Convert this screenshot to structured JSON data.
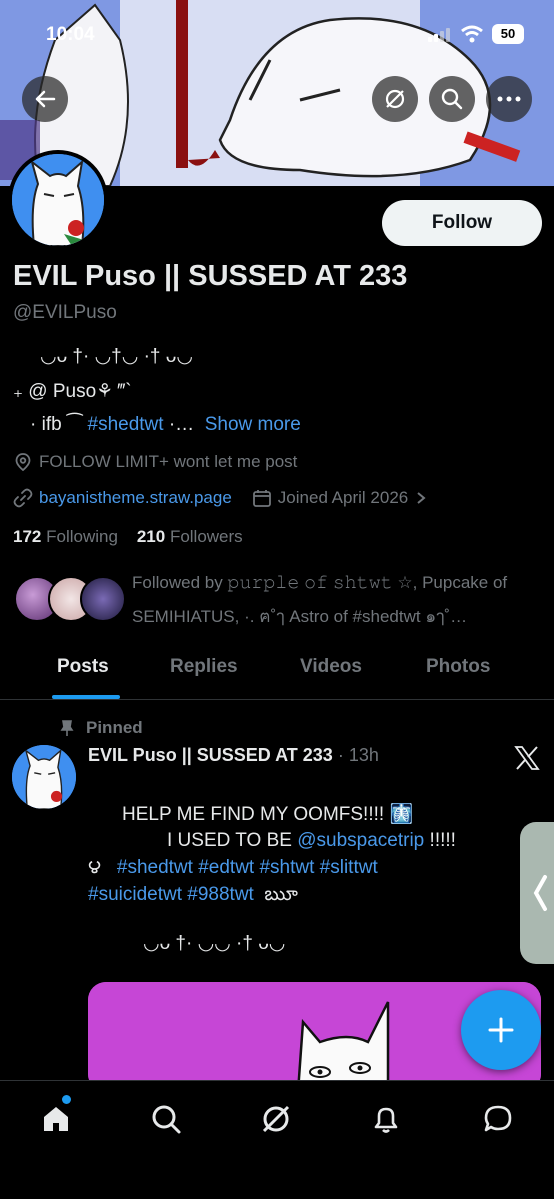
{
  "status_bar": {
    "time": "10:04",
    "battery": "50"
  },
  "profile": {
    "display_name": "EVIL Puso || SUSSED AT 233",
    "handle": "@EVILPuso",
    "follow_label": "Follow",
    "bio_line1": "◡ᴗ †·    ◡†◡      ·†  ᴗ◡",
    "bio_line2": "₊ @ Puso⚘    ‴`",
    "bio_line3_prefix": "· ifb ⁀ ",
    "bio_line3_tag": "#shedtwt",
    "bio_line3_suffix": " ·…",
    "show_more": "Show more",
    "location": "FOLLOW LIMIT+ wont let me post",
    "website": "bayanistheme.straw.page",
    "joined": "Joined April 2026",
    "following_count": "172",
    "following_label": "Following",
    "followers_count": "210",
    "followers_label": "Followers",
    "followed_by": "Followed by 𝚙𝚞𝚛𝚙𝚕𝚎 𝚘𝚏 𝚜𝚑𝚝𝚠𝚝 ☆, Pupcake of SEMIHIATUS, ·. ฅ˚ๅ Astro of #shedtwt ๑ๅ˚…"
  },
  "tabs": [
    "Posts",
    "Replies",
    "Videos",
    "Photos"
  ],
  "post": {
    "pinned_label": "Pinned",
    "author": "EVIL Puso || SUSSED AT 233",
    "time": "· 13h",
    "line1": "HELP ME FIND MY OOMFS!!!!  🩻",
    "line2_prefix": "I USED TO BE ",
    "line2_mention": "@subspacetrip",
    "line2_suffix": " !!!!!",
    "line3_open": "౪",
    "line3_tags": "#shedtwt #edtwt #shtwt  #slittwt",
    "line4_tags": "#suicidetwt #988twt",
    "line4_close": "ౠ",
    "line5": "◡ᴗ †·      ◡◡      ·†  ᴗ◡"
  },
  "colors": {
    "accent": "#1d9bf0",
    "link": "#4a99e9",
    "muted": "#71767b",
    "media_bg": "#c646d6"
  }
}
